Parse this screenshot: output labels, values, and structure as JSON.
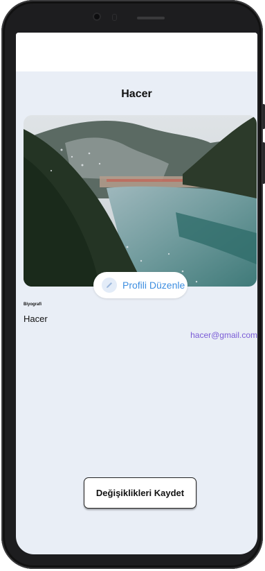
{
  "profile": {
    "title": "Hacer",
    "edit_button_label": "Profili Düzenle",
    "bio_label": "Biyografi",
    "bio_value": "Hacer",
    "email": "hacer@gmail.com"
  },
  "actions": {
    "save_label": "Değişiklikleri Kaydet"
  },
  "icons": {
    "edit": "pencil-icon",
    "photo": "landscape-photo"
  },
  "colors": {
    "screen_background": "#e9eef6",
    "edit_label": "#3d8ee0",
    "email": "#7a5bd6"
  }
}
